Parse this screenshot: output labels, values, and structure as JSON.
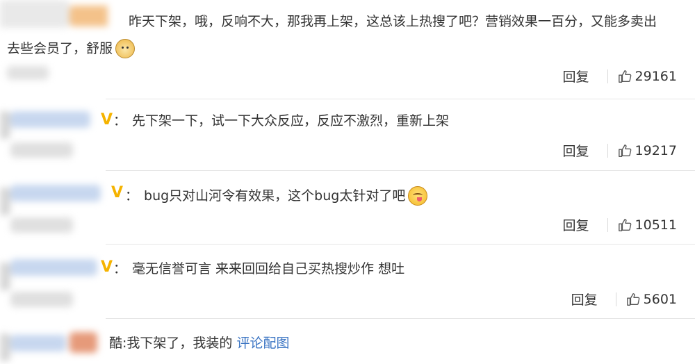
{
  "comments": [
    {
      "text_line1": "昨天下架，哦，反响不大，那我再上架，这总该上热搜了吧？营销效果一百分，又能多卖出",
      "text_line2": "去些会员了，舒服",
      "emoji": "doge-emoji",
      "reply_label": "回复",
      "likes": "29161"
    },
    {
      "badge": "V",
      "separator": "：",
      "text": "先下架一下，试一下大众反应，反应不激烈，重新上架",
      "reply_label": "回复",
      "likes": "19217"
    },
    {
      "badge": "V",
      "separator": "：",
      "text": "bug只对山河令有效果，这个bug太针对了吧",
      "emoji": "yum-emoji",
      "reply_label": "回复",
      "likes": "10511"
    },
    {
      "badge": "V",
      "separator": "：",
      "text": "毫无信誉可言 来来回回给自己买热搜炒作 想吐",
      "reply_label": "回复",
      "likes": "5601"
    },
    {
      "text_prefix": "酷:我下架了，我装的 ",
      "link": "评论配图"
    }
  ],
  "colors": {
    "badge": "#f5b300",
    "link": "#3d76c4",
    "text": "#333333",
    "divider": "#e6e6e6"
  }
}
